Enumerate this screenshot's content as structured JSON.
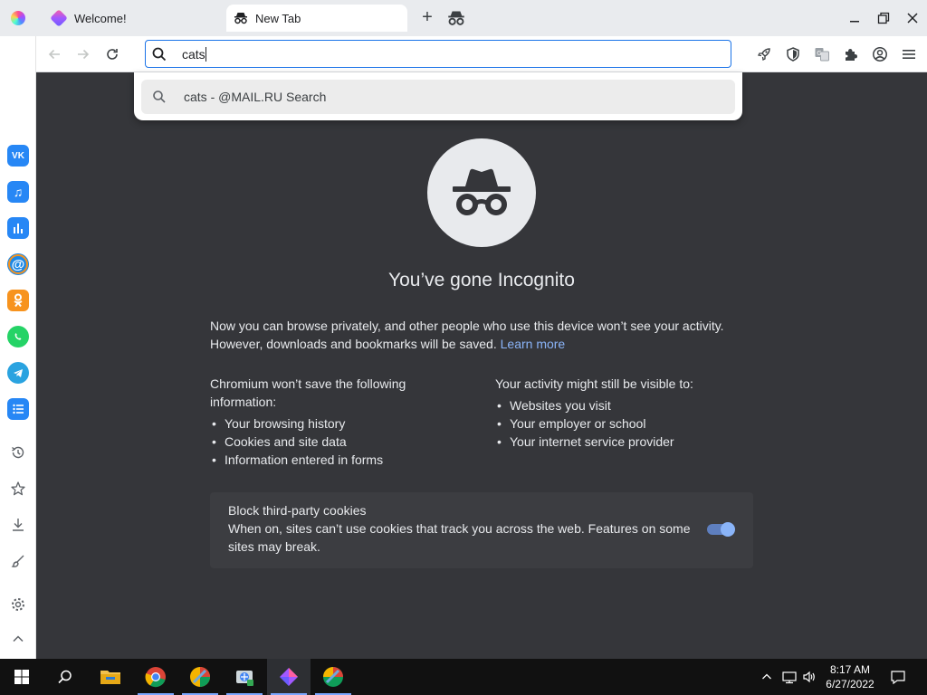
{
  "tabs": [
    {
      "label": "Welcome!",
      "favicon": "browser-gem-icon",
      "active": false
    },
    {
      "label": "New Tab",
      "favicon": "incognito-icon",
      "active": true
    }
  ],
  "omnibox": {
    "value": "cats",
    "icon": "search-icon"
  },
  "suggestions": [
    {
      "text": "cats - @MAIL.RU Search",
      "icon": "search-icon"
    }
  ],
  "toolbar_icons": [
    "rocket-icon",
    "shield-icon",
    "translate-icon",
    "extensions-icon",
    "account-icon",
    "menu-icon"
  ],
  "sidebar": {
    "apps": [
      {
        "name": "vk",
        "label": "VK",
        "color": "#2787f5"
      },
      {
        "name": "music",
        "label": "♫",
        "color": "#2787f5"
      },
      {
        "name": "stats",
        "label": "",
        "color": "#2787f5"
      },
      {
        "name": "mail",
        "label": "@",
        "color": "#1e88e5"
      },
      {
        "name": "ok",
        "label": "",
        "color": "#f7931e"
      },
      {
        "name": "whatsapp",
        "label": "",
        "color": "#25d366"
      },
      {
        "name": "telegram",
        "label": "",
        "color": "#2aa3e0"
      },
      {
        "name": "notes",
        "label": "",
        "color": "#2787f5"
      }
    ],
    "utilities": [
      "history-icon",
      "star-icon",
      "download-icon",
      "brush-icon",
      "settings-icon",
      "chevron-up-icon"
    ]
  },
  "incognito": {
    "title": "You’ve gone Incognito",
    "intro": "Now you can browse privately, and other people who use this device won’t see your activity. However, downloads and bookmarks will be saved.",
    "learn_more": "Learn more",
    "left_heading": "Chromium won’t save the following information:",
    "left_items": [
      "Your browsing history",
      "Cookies and site data",
      "Information entered in forms"
    ],
    "right_heading": "Your activity might still be visible to:",
    "right_items": [
      "Websites you visit",
      "Your employer or school",
      "Your internet service provider"
    ],
    "cookie_title": "Block third-party cookies",
    "cookie_desc": "When on, sites can’t use cookies that track you across the web. Features on some sites may break.",
    "cookie_enabled": true
  },
  "colors": {
    "page_bg": "#35363a",
    "accent": "#8ab4f8",
    "omnibox_border": "#1a73e8"
  },
  "taskbar": {
    "items": [
      "start-icon",
      "search-icon",
      "file-explorer-icon",
      "chrome-icon",
      "browser-app-icon",
      "network-utility-icon",
      "incognito-browser-icon",
      "browser-app-icon-2"
    ],
    "time": "8:17 AM",
    "date": "6/27/2022"
  }
}
